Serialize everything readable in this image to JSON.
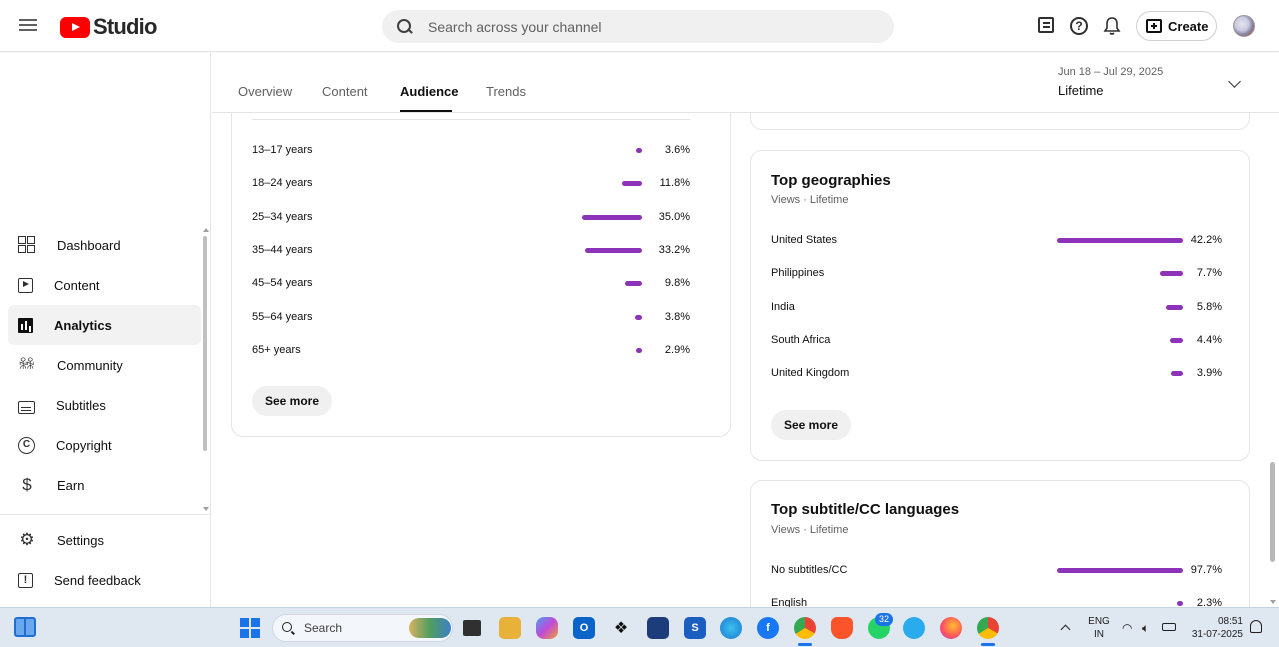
{
  "app": {
    "logo_text": "Studio"
  },
  "header": {
    "search_placeholder": "Search across your channel",
    "create_label": "Create"
  },
  "sidebar": {
    "items": [
      {
        "label": "Dashboard",
        "icon": "dashboard-icon"
      },
      {
        "label": "Content",
        "icon": "content-icon"
      },
      {
        "label": "Analytics",
        "icon": "analytics-icon",
        "active": true
      },
      {
        "label": "Community",
        "icon": "community-icon"
      },
      {
        "label": "Subtitles",
        "icon": "subtitles-icon"
      },
      {
        "label": "Copyright",
        "icon": "copyright-icon"
      },
      {
        "label": "Earn",
        "icon": "earn-icon"
      }
    ],
    "bottom_items": [
      {
        "label": "Settings",
        "icon": "settings-icon"
      },
      {
        "label": "Send feedback",
        "icon": "feedback-icon"
      }
    ]
  },
  "tabs": {
    "items": [
      "Overview",
      "Content",
      "Audience",
      "Trends"
    ],
    "active": "Audience"
  },
  "date_range": {
    "dates": "Jun 18 – Jul 29, 2025",
    "label": "Lifetime"
  },
  "age_card": {
    "rows": [
      {
        "label": "13–17 years",
        "value": 3.6,
        "display": "3.6%"
      },
      {
        "label": "18–24 years",
        "value": 11.8,
        "display": "11.8%"
      },
      {
        "label": "25–34 years",
        "value": 35.0,
        "display": "35.0%"
      },
      {
        "label": "35–44 years",
        "value": 33.2,
        "display": "33.2%"
      },
      {
        "label": "45–54 years",
        "value": 9.8,
        "display": "9.8%"
      },
      {
        "label": "55–64 years",
        "value": 3.8,
        "display": "3.8%"
      },
      {
        "label": "65+ years",
        "value": 2.9,
        "display": "2.9%"
      }
    ],
    "see_more": "See more"
  },
  "geo_card": {
    "title": "Top geographies",
    "subtitle": "Views · Lifetime",
    "rows": [
      {
        "label": "United States",
        "value": 42.2,
        "display": "42.2%"
      },
      {
        "label": "Philippines",
        "value": 7.7,
        "display": "7.7%"
      },
      {
        "label": "India",
        "value": 5.8,
        "display": "5.8%"
      },
      {
        "label": "South Africa",
        "value": 4.4,
        "display": "4.4%"
      },
      {
        "label": "United Kingdom",
        "value": 3.9,
        "display": "3.9%"
      }
    ],
    "see_more": "See more"
  },
  "subtitle_card": {
    "title": "Top subtitle/CC languages",
    "subtitle": "Views · Lifetime",
    "rows": [
      {
        "label": "No subtitles/CC",
        "value": 97.7,
        "display": "97.7%"
      },
      {
        "label": "English",
        "value": 2.3,
        "display": "2.3%"
      }
    ]
  },
  "bar_color": "#8c33b9",
  "taskbar": {
    "search_label": "Search",
    "whatsapp_badge": "32",
    "lang_line1": "ENG",
    "lang_line2": "IN",
    "time": "08:51",
    "date": "31-07-2025"
  }
}
